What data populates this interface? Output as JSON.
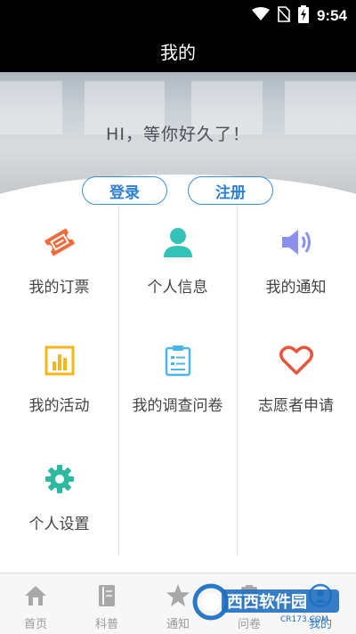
{
  "status": {
    "time": "9:54"
  },
  "header": {
    "title": "我的"
  },
  "hero": {
    "greeting": "HI，等你好久了！"
  },
  "auth": {
    "login": "登录",
    "register": "注册"
  },
  "menu": [
    {
      "label": "我的订票",
      "icon": "ticket-icon"
    },
    {
      "label": "个人信息",
      "icon": "person-icon"
    },
    {
      "label": "我的通知",
      "icon": "speaker-icon"
    },
    {
      "label": "我的活动",
      "icon": "bar-chart-icon"
    },
    {
      "label": "我的调查问卷",
      "icon": "clipboard-icon"
    },
    {
      "label": "志愿者申请",
      "icon": "heart-icon"
    },
    {
      "label": "个人设置",
      "icon": "gear-icon"
    }
  ],
  "tabs": [
    {
      "label": "首页",
      "icon": "home-icon"
    },
    {
      "label": "科普",
      "icon": "book-icon"
    },
    {
      "label": "通知",
      "icon": "star-icon"
    },
    {
      "label": "问卷",
      "icon": "clipboard-icon"
    },
    {
      "label": "我的",
      "icon": "person-icon",
      "active": true
    }
  ],
  "watermark": {
    "text": "西西软件园",
    "sub": "CR173.COM"
  },
  "colors": {
    "accent": "#2d7fd0",
    "ticket": "#f06a3c",
    "person": "#33c2b8",
    "speaker": "#8b8ff0",
    "chart": "#f5b51b",
    "clipboard": "#4cb6e6",
    "heart": "#e8553a",
    "gear": "#2fb8a0"
  }
}
